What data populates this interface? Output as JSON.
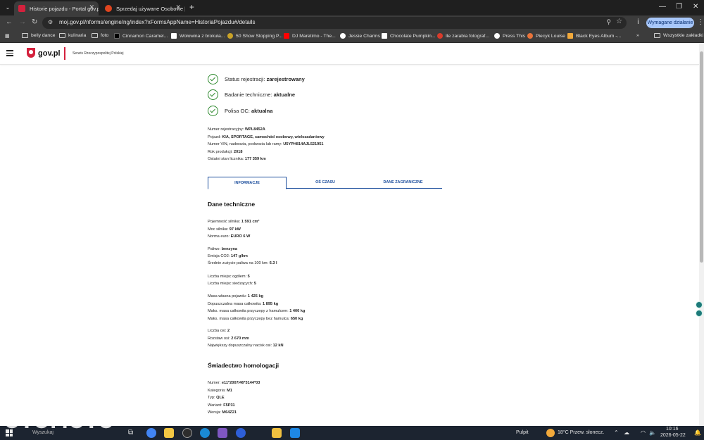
{
  "browser": {
    "tabs": [
      {
        "title": "Historie pojazdu - Portal gov.pl",
        "active": true,
        "favicon_color": "#d4213d"
      },
      {
        "title": "Sprzedaj używane Osobowe | O",
        "active": false,
        "favicon_color": "#e0451f"
      }
    ],
    "new_tab": "+",
    "window_controls": {
      "minimize": "—",
      "maximize": "❐",
      "close": "✕"
    },
    "url": "moj.gov.pl/nforms/engine/ng/index?xFormsAppName=HistoriaPojazdu#/details",
    "action_button": "Wymagane działanie",
    "bookmarks": [
      {
        "label": "belly dance",
        "icon": "folder"
      },
      {
        "label": "kulinaria",
        "icon": "folder"
      },
      {
        "label": "foto",
        "icon": "folder"
      },
      {
        "label": "Cinnamon Caramel...",
        "icon": "site",
        "color": "#000000"
      },
      {
        "label": "Wołowina z brokuła...",
        "icon": "site",
        "color": "#ffffff"
      },
      {
        "label": "50 Show Stopping P...",
        "icon": "site",
        "color": "#c9a227"
      },
      {
        "label": "DJ Maretimo - The...",
        "icon": "site",
        "color": "#ff0000"
      },
      {
        "label": "Jessie Charms",
        "icon": "site",
        "color": "#ffffff"
      },
      {
        "label": "Chocolate Pumpkin...",
        "icon": "site",
        "color": "#ffffff"
      },
      {
        "label": "Ile zarabia fotograf...",
        "icon": "site",
        "color": "#d93b2b"
      },
      {
        "label": "Press This",
        "icon": "site",
        "color": "#ffffff"
      },
      {
        "label": "Piecyk Louise",
        "icon": "site",
        "color": "#e8733a"
      },
      {
        "label": "Black Eyes Album -...",
        "icon": "site",
        "color": "#f2a93b"
      }
    ],
    "bookmarks_overflow": "»",
    "all_bookmarks": "Wszystkie zakładki"
  },
  "site": {
    "logo": "gov.pl",
    "subtitle": "Serwis Rzeczypospolitej Polskiej"
  },
  "status": [
    {
      "label": "Status rejestracji: ",
      "value": "zarejestrowany"
    },
    {
      "label": "Badanie techniczne: ",
      "value": "aktualne"
    },
    {
      "label": "Polisa OC: ",
      "value": "aktualna"
    }
  ],
  "vehicle": [
    {
      "label": "Numer rejestracyjny: ",
      "value": "WPL8452A"
    },
    {
      "label": "Pojazd: ",
      "value": "KIA, SPORTAGE, samochód osobowy, wielozadaniowy"
    },
    {
      "label": "Numer VIN, nadwozia, podwozia lub ramy: ",
      "value": "U5YPH814AJL521951"
    },
    {
      "label": "Rok produkcji: ",
      "value": "2018"
    },
    {
      "label": "Ostatni stan licznika: ",
      "value": "177 359 km"
    }
  ],
  "page_tabs": [
    {
      "label": "INFORMACJE",
      "active": true
    },
    {
      "label": "OŚ CZASU",
      "active": false
    },
    {
      "label": "DANE ZAGRANICZNE",
      "active": false
    }
  ],
  "technical": {
    "title": "Dane techniczne",
    "groups": [
      [
        {
          "label": "Pojemność silnika: ",
          "value": "1 591 cm³"
        },
        {
          "label": "Moc silnika: ",
          "value": "97 kW"
        },
        {
          "label": "Norma euro: ",
          "value": "EURO 6 W"
        }
      ],
      [
        {
          "label": "Paliwo: ",
          "value": "benzyna"
        },
        {
          "label": "Emisja CO2: ",
          "value": "147 g/km"
        },
        {
          "label": "Średnie zużycie paliwa na 100 km: ",
          "value": "6.3 l"
        }
      ],
      [
        {
          "label": "Liczba miejsc ogółem: ",
          "value": "5"
        },
        {
          "label": "Liczba miejsc siedzących: ",
          "value": "5"
        }
      ],
      [
        {
          "label": "Masa własna pojazdu: ",
          "value": "1 425 kg"
        },
        {
          "label": "Dopuszczalna masa całkowita: ",
          "value": "1 895 kg"
        },
        {
          "label": "Maks. masa całkowita przyczepy z hamulcem: ",
          "value": "1 400 kg"
        },
        {
          "label": "Maks. masa całkowita przyczepy bez hamulca: ",
          "value": "650 kg"
        }
      ],
      [
        {
          "label": "Liczba osi: ",
          "value": "2"
        },
        {
          "label": "Rozstaw osi: ",
          "value": "2 670 mm"
        },
        {
          "label": "Największy dopuszczalny nacisk osi: ",
          "value": "12 kN"
        }
      ]
    ]
  },
  "homologation": {
    "title": "Świadectwo homologacji",
    "items": [
      {
        "label": "Numer: ",
        "value": "e11*2007/46*3144*03"
      },
      {
        "label": "Kategoria: ",
        "value": "M1"
      },
      {
        "label": "Typ: ",
        "value": "QLE"
      },
      {
        "label": "Wariant: ",
        "value": "F5P31"
      },
      {
        "label": "Wersja: ",
        "value": "M64Z21"
      }
    ]
  },
  "taskbar": {
    "watermark": "OTOMOTO",
    "search": "Wyszukaj",
    "desktop": "Pulpit",
    "weather": "18°C  Przew. słonecz.",
    "time": "10:16",
    "date": "2026-05-22"
  }
}
